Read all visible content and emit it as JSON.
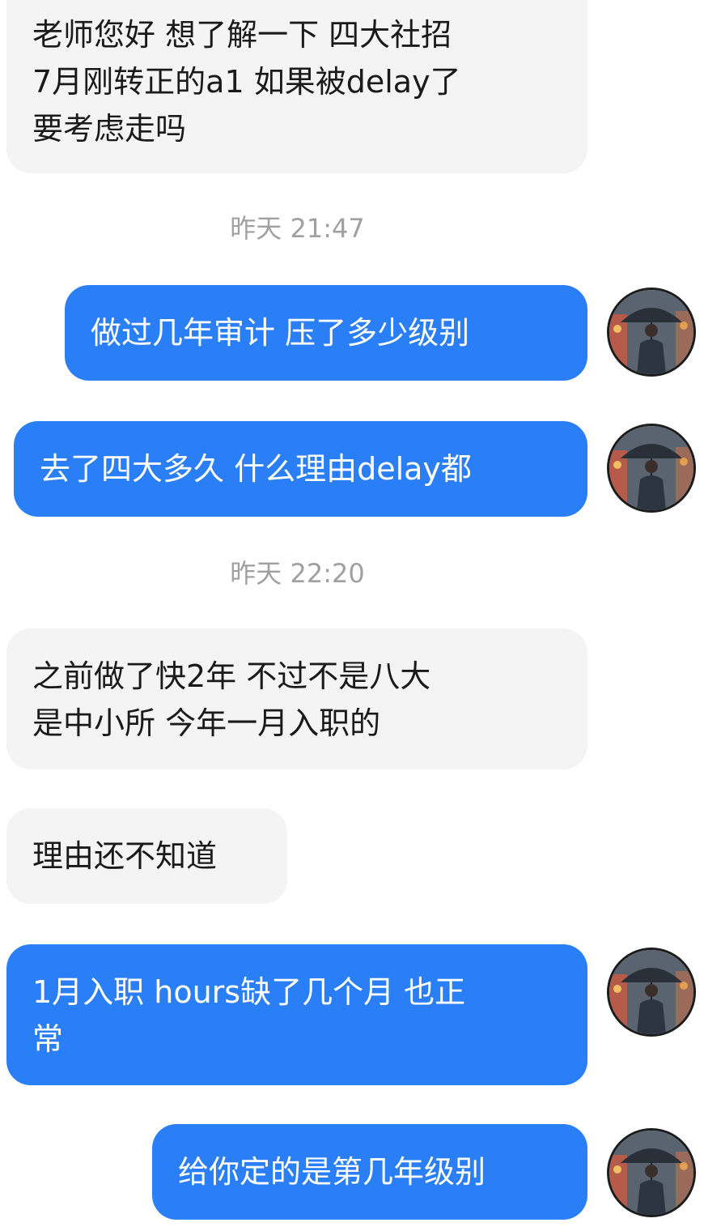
{
  "messages": [
    {
      "side": "incoming",
      "text": "老师您好 想了解一下 四大社招\n7月刚转正的a1 如果被delay了\n要考虑走吗"
    },
    {
      "type": "timestamp",
      "text": "昨天 21:47"
    },
    {
      "side": "outgoing",
      "text": "做过几年审计 压了多少级别"
    },
    {
      "side": "outgoing",
      "text": "去了四大多久 什么理由delay都"
    },
    {
      "type": "timestamp",
      "text": "昨天 22:20"
    },
    {
      "side": "incoming",
      "text": "之前做了快2年 不过不是八大\n是中小所 今年一月入职的"
    },
    {
      "side": "incoming",
      "text": "理由还不知道"
    },
    {
      "side": "outgoing",
      "text": "1月入职 hours缺了几个月 也正\n常"
    },
    {
      "side": "outgoing",
      "text": "给你定的是第几年级别"
    }
  ],
  "colors": {
    "outgoing_bubble": "#2a7ff6",
    "incoming_bubble": "#f4f4f4",
    "timestamp_text": "#a0a0a0"
  },
  "avatar_icon": "man-with-umbrella-avatar-icon"
}
